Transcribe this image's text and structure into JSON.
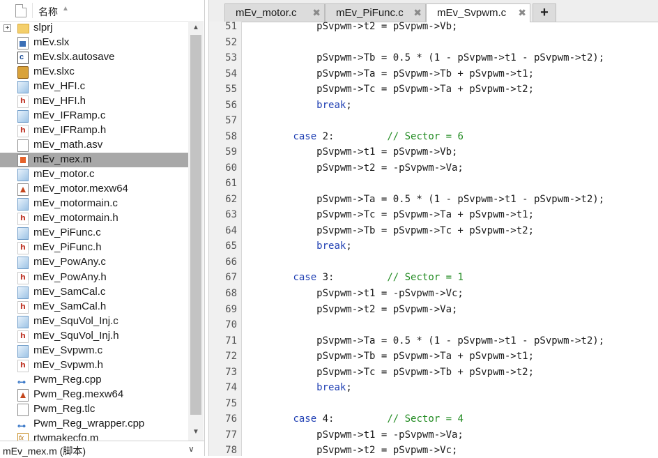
{
  "file_browser": {
    "header": {
      "label": "名称"
    },
    "items": [
      {
        "name": "slprj",
        "icon": "folder-icon",
        "kind": "folder",
        "expander": "+"
      },
      {
        "name": "mEv.slx",
        "icon": "simulink-model-icon",
        "kind": "slx"
      },
      {
        "name": "mEv.slx.autosave",
        "icon": "autosave-file-icon",
        "kind": "auto"
      },
      {
        "name": "mEv.slxc",
        "icon": "slxc-file-icon",
        "kind": "slxc"
      },
      {
        "name": "mEv_HFI.c",
        "icon": "c-file-icon",
        "kind": "c"
      },
      {
        "name": "mEv_HFI.h",
        "icon": "h-file-icon",
        "kind": "h"
      },
      {
        "name": "mEv_IFRamp.c",
        "icon": "c-file-icon",
        "kind": "c"
      },
      {
        "name": "mEv_IFRamp.h",
        "icon": "h-file-icon",
        "kind": "h"
      },
      {
        "name": "mEv_math.asv",
        "icon": "blank-file-icon",
        "kind": "page"
      },
      {
        "name": "mEv_mex.m",
        "icon": "matlab-script-icon",
        "kind": "m",
        "selected": true
      },
      {
        "name": "mEv_motor.c",
        "icon": "c-file-icon",
        "kind": "c"
      },
      {
        "name": "mEv_motor.mexw64",
        "icon": "mex-file-icon",
        "kind": "mex"
      },
      {
        "name": "mEv_motormain.c",
        "icon": "c-file-icon",
        "kind": "c"
      },
      {
        "name": "mEv_motormain.h",
        "icon": "h-file-icon",
        "kind": "h"
      },
      {
        "name": "mEv_PiFunc.c",
        "icon": "c-file-icon",
        "kind": "c"
      },
      {
        "name": "mEv_PiFunc.h",
        "icon": "h-file-icon",
        "kind": "h"
      },
      {
        "name": "mEv_PowAny.c",
        "icon": "c-file-icon",
        "kind": "c"
      },
      {
        "name": "mEv_PowAny.h",
        "icon": "h-file-icon",
        "kind": "h"
      },
      {
        "name": "mEv_SamCal.c",
        "icon": "c-file-icon",
        "kind": "c"
      },
      {
        "name": "mEv_SamCal.h",
        "icon": "h-file-icon",
        "kind": "h"
      },
      {
        "name": "mEv_SquVol_Inj.c",
        "icon": "c-file-icon",
        "kind": "c"
      },
      {
        "name": "mEv_SquVol_Inj.h",
        "icon": "h-file-icon",
        "kind": "h"
      },
      {
        "name": "mEv_Svpwm.c",
        "icon": "c-file-icon",
        "kind": "c"
      },
      {
        "name": "mEv_Svpwm.h",
        "icon": "h-file-icon",
        "kind": "h"
      },
      {
        "name": "Pwm_Reg.cpp",
        "icon": "cpp-file-icon",
        "kind": "link"
      },
      {
        "name": "Pwm_Reg.mexw64",
        "icon": "mex-file-icon",
        "kind": "mex"
      },
      {
        "name": "Pwm_Reg.tlc",
        "icon": "tlc-file-icon",
        "kind": "page"
      },
      {
        "name": "Pwm_Reg_wrapper.cpp",
        "icon": "cpp-file-icon",
        "kind": "link"
      },
      {
        "name": "rtwmakecfg.m",
        "icon": "function-file-icon",
        "kind": "fx"
      }
    ],
    "status": "mEv_mex.m (脚本)"
  },
  "editor": {
    "tabs": [
      {
        "label": "mEv_motor.c",
        "close": "✖",
        "active": false
      },
      {
        "label": "mEv_PiFunc.c",
        "close": "✖",
        "active": false
      },
      {
        "label": "mEv_Svpwm.c",
        "close": "✖",
        "active": true
      }
    ],
    "add_tab": "+",
    "lines": [
      {
        "n": "51",
        "segs": [
          {
            "t": "            pSvpwm->t2 = pSvpwm->Vb;",
            "c": "plain"
          }
        ]
      },
      {
        "n": "52",
        "segs": [
          {
            "t": "",
            "c": "plain"
          }
        ]
      },
      {
        "n": "53",
        "segs": [
          {
            "t": "            pSvpwm->Tb = 0.5 * (1 - pSvpwm->t1 - pSvpwm->t2);",
            "c": "plain"
          }
        ]
      },
      {
        "n": "54",
        "segs": [
          {
            "t": "            pSvpwm->Ta = pSvpwm->Tb + pSvpwm->t1;",
            "c": "plain"
          }
        ]
      },
      {
        "n": "55",
        "segs": [
          {
            "t": "            pSvpwm->Tc = pSvpwm->Ta + pSvpwm->t2;",
            "c": "plain"
          }
        ]
      },
      {
        "n": "56",
        "segs": [
          {
            "t": "            ",
            "c": "plain"
          },
          {
            "t": "break",
            "c": "kw"
          },
          {
            "t": ";",
            "c": "plain"
          }
        ]
      },
      {
        "n": "57",
        "segs": [
          {
            "t": "",
            "c": "plain"
          }
        ]
      },
      {
        "n": "58",
        "segs": [
          {
            "t": "        ",
            "c": "plain"
          },
          {
            "t": "case",
            "c": "kw"
          },
          {
            "t": " 2:         ",
            "c": "plain"
          },
          {
            "t": "// Sector = 6",
            "c": "cm"
          }
        ]
      },
      {
        "n": "59",
        "segs": [
          {
            "t": "            pSvpwm->t1 = pSvpwm->Vb;",
            "c": "plain"
          }
        ]
      },
      {
        "n": "60",
        "segs": [
          {
            "t": "            pSvpwm->t2 = -pSvpwm->Va;",
            "c": "plain"
          }
        ]
      },
      {
        "n": "61",
        "segs": [
          {
            "t": "",
            "c": "plain"
          }
        ]
      },
      {
        "n": "62",
        "segs": [
          {
            "t": "            pSvpwm->Ta = 0.5 * (1 - pSvpwm->t1 - pSvpwm->t2);",
            "c": "plain"
          }
        ]
      },
      {
        "n": "63",
        "segs": [
          {
            "t": "            pSvpwm->Tc = pSvpwm->Ta + pSvpwm->t1;",
            "c": "plain"
          }
        ]
      },
      {
        "n": "64",
        "segs": [
          {
            "t": "            pSvpwm->Tb = pSvpwm->Tc + pSvpwm->t2;",
            "c": "plain"
          }
        ]
      },
      {
        "n": "65",
        "segs": [
          {
            "t": "            ",
            "c": "plain"
          },
          {
            "t": "break",
            "c": "kw"
          },
          {
            "t": ";",
            "c": "plain"
          }
        ]
      },
      {
        "n": "66",
        "segs": [
          {
            "t": "",
            "c": "plain"
          }
        ]
      },
      {
        "n": "67",
        "segs": [
          {
            "t": "        ",
            "c": "plain"
          },
          {
            "t": "case",
            "c": "kw"
          },
          {
            "t": " 3:         ",
            "c": "plain"
          },
          {
            "t": "// Sector = 1",
            "c": "cm"
          }
        ]
      },
      {
        "n": "68",
        "segs": [
          {
            "t": "            pSvpwm->t1 = -pSvpwm->Vc;",
            "c": "plain"
          }
        ]
      },
      {
        "n": "69",
        "segs": [
          {
            "t": "            pSvpwm->t2 = pSvpwm->Va;",
            "c": "plain"
          }
        ]
      },
      {
        "n": "70",
        "segs": [
          {
            "t": "",
            "c": "plain"
          }
        ]
      },
      {
        "n": "71",
        "segs": [
          {
            "t": "            pSvpwm->Ta = 0.5 * (1 - pSvpwm->t1 - pSvpwm->t2);",
            "c": "plain"
          }
        ]
      },
      {
        "n": "72",
        "segs": [
          {
            "t": "            pSvpwm->Tb = pSvpwm->Ta + pSvpwm->t1;",
            "c": "plain"
          }
        ]
      },
      {
        "n": "73",
        "segs": [
          {
            "t": "            pSvpwm->Tc = pSvpwm->Tb + pSvpwm->t2;",
            "c": "plain"
          }
        ]
      },
      {
        "n": "74",
        "segs": [
          {
            "t": "            ",
            "c": "plain"
          },
          {
            "t": "break",
            "c": "kw"
          },
          {
            "t": ";",
            "c": "plain"
          }
        ]
      },
      {
        "n": "75",
        "segs": [
          {
            "t": "",
            "c": "plain"
          }
        ]
      },
      {
        "n": "76",
        "segs": [
          {
            "t": "        ",
            "c": "plain"
          },
          {
            "t": "case",
            "c": "kw"
          },
          {
            "t": " 4:         ",
            "c": "plain"
          },
          {
            "t": "// Sector = 4",
            "c": "cm"
          }
        ]
      },
      {
        "n": "77",
        "segs": [
          {
            "t": "            pSvpwm->t1 = -pSvpwm->Va;",
            "c": "plain"
          }
        ]
      },
      {
        "n": "78",
        "segs": [
          {
            "t": "            pSvpwm->t2 = pSvpwm->Vc;",
            "c": "plain"
          }
        ]
      }
    ]
  },
  "colors": {
    "selection": "#a8a8a8",
    "keyword": "#1f3fb3",
    "comment": "#228b22"
  }
}
